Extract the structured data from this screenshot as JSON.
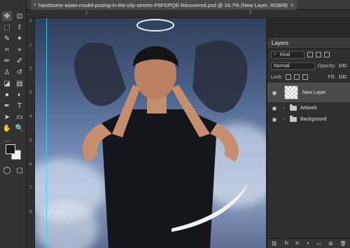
{
  "document": {
    "tab_title": "handsome-asian-model-posing-in-the-city-streets-P6FGPQE-Recovered.psd @ 16.7% (New Layer, RGB/8)",
    "modified_marker": "*",
    "close_glyph": "×"
  },
  "rulers": {
    "top_ticks": [
      "1",
      "2"
    ],
    "left_ticks": [
      "0",
      "1",
      "2",
      "3",
      "4",
      "5",
      "6",
      "7",
      "8"
    ]
  },
  "toolbar": {
    "tools": [
      {
        "name": "move-tool-icon",
        "glyph": "✥"
      },
      {
        "name": "artboard-tool-icon",
        "glyph": "⊡"
      },
      {
        "name": "marquee-tool-icon",
        "glyph": "⬚"
      },
      {
        "name": "lasso-tool-icon",
        "glyph": "ℓ"
      },
      {
        "name": "quick-select-tool-icon",
        "glyph": "✎"
      },
      {
        "name": "magic-wand-tool-icon",
        "glyph": "✦"
      },
      {
        "name": "crop-tool-icon",
        "glyph": "⌗"
      },
      {
        "name": "eyedropper-tool-icon",
        "glyph": "⌖"
      },
      {
        "name": "brush-tool-icon",
        "glyph": "✏"
      },
      {
        "name": "pencil-tool-icon",
        "glyph": "✐"
      },
      {
        "name": "clone-stamp-tool-icon",
        "glyph": "♙"
      },
      {
        "name": "history-brush-tool-icon",
        "glyph": "↺"
      },
      {
        "name": "eraser-tool-icon",
        "glyph": "◪"
      },
      {
        "name": "gradient-tool-icon",
        "glyph": "▤"
      },
      {
        "name": "blur-tool-icon",
        "glyph": "●"
      },
      {
        "name": "dodge-tool-icon",
        "glyph": "◐"
      },
      {
        "name": "pen-tool-icon",
        "glyph": "✒"
      },
      {
        "name": "type-tool-icon",
        "glyph": "T"
      },
      {
        "name": "path-select-tool-icon",
        "glyph": "➤"
      },
      {
        "name": "shape-tool-icon",
        "glyph": "▭"
      },
      {
        "name": "hand-tool-icon",
        "glyph": "✋"
      },
      {
        "name": "zoom-tool-icon",
        "glyph": "🔍"
      },
      {
        "name": "more-tools-icon",
        "glyph": "…"
      },
      {
        "name": "quick-mask-icon",
        "glyph": "◯"
      },
      {
        "name": "screen-mode-icon",
        "glyph": "▢"
      }
    ]
  },
  "layers_panel": {
    "title": "Layers",
    "filter_kind": "Kind",
    "blend_mode": "Normal",
    "opacity_label": "Opacity:",
    "opacity_value": "100",
    "lock_label": "Lock:",
    "fill_label": "Fill:",
    "fill_value": "100",
    "layers": [
      {
        "name": "New Layer",
        "type": "pixel",
        "visible": true,
        "active": true
      },
      {
        "name": "Artwork",
        "type": "group",
        "visible": true,
        "active": false
      },
      {
        "name": "Background",
        "type": "group",
        "visible": true,
        "active": false
      }
    ],
    "footer_icons": [
      "link-icon",
      "fx-icon",
      "mask-icon",
      "adjustment-icon",
      "folder-icon",
      "new-layer-icon",
      "trash-icon"
    ],
    "footer_glyphs": [
      "⛓",
      "fx",
      "◘",
      "◑",
      "▭",
      "⊞",
      "🗑"
    ]
  },
  "colors": {
    "app_bg": "#282828",
    "guide": "#1ee0ff",
    "panel_bg": "#2f2f2f"
  }
}
